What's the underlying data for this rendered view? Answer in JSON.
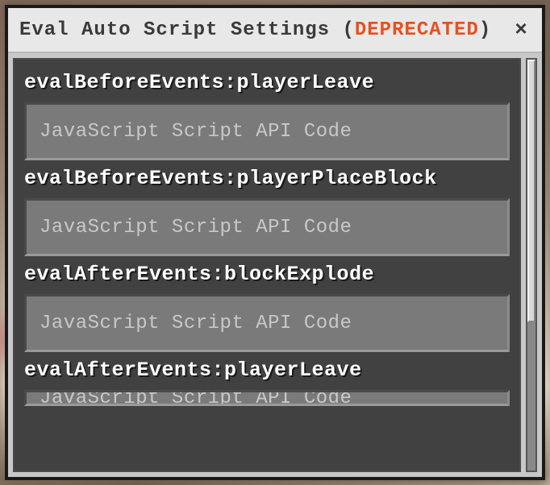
{
  "window": {
    "title_prefix": "Eval Auto Script Settings (",
    "title_deprecated": "DEPRECATED",
    "title_suffix": ")",
    "close_glyph": "×"
  },
  "fields": [
    {
      "label": "evalBeforeEvents:playerLeave",
      "placeholder": "JavaScript Script API Code"
    },
    {
      "label": "evalBeforeEvents:playerPlaceBlock",
      "placeholder": "JavaScript Script API Code"
    },
    {
      "label": "evalAfterEvents:blockExplode",
      "placeholder": "JavaScript Script API Code"
    },
    {
      "label": "evalAfterEvents:playerLeave",
      "placeholder": "JavaScript Script API Code"
    }
  ]
}
